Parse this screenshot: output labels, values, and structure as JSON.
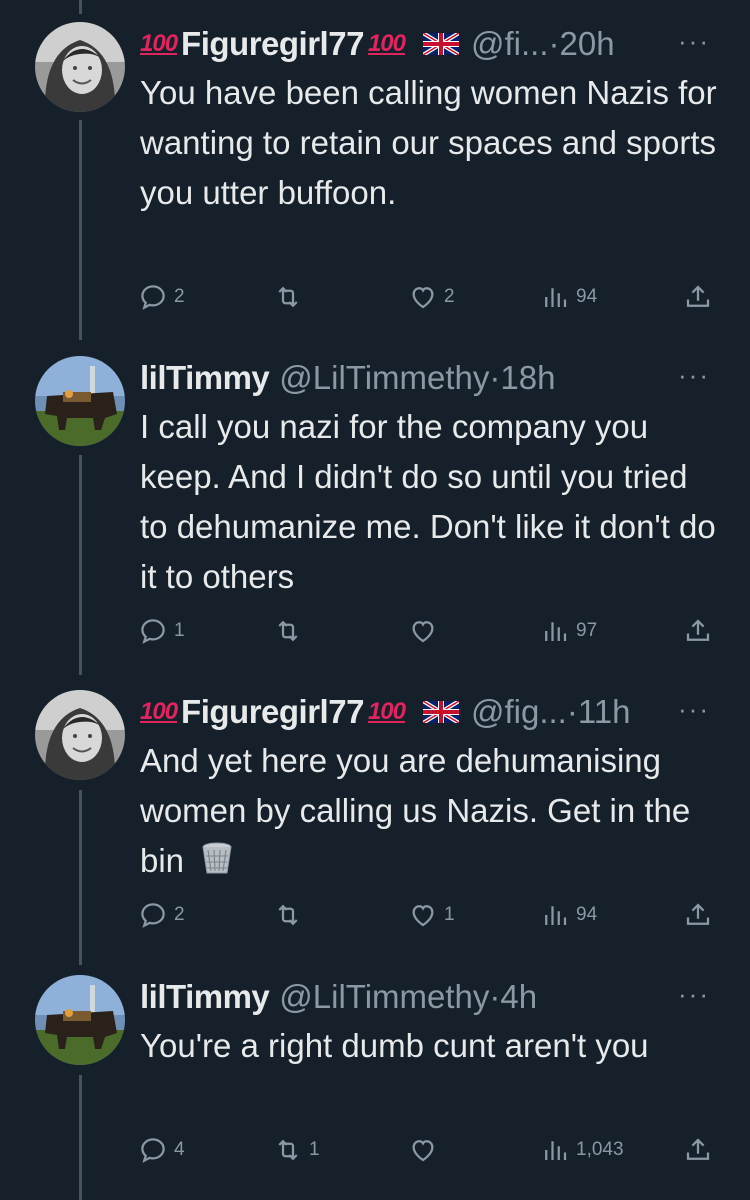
{
  "tweets": [
    {
      "display_name": "Figuregirl77",
      "prefix_emoji": "💯",
      "suffix_emoji": "💯",
      "flag": "🇬🇧",
      "handle": "@fi...",
      "separator": "·",
      "time": "20h",
      "more": "···",
      "text": "You have been calling women Nazis for wanting to retain our spaces and sports you utter buffoon.",
      "replies": "2",
      "retweets": "",
      "likes": "2",
      "views": "94"
    },
    {
      "display_name": "lilTimmy",
      "handle": "@LilTimmethy",
      "separator": "·",
      "time": "18h",
      "more": "···",
      "text": "I call you nazi for the company you keep. And I didn't do so until you tried to dehumanize me. Don't like it don't do it to others",
      "replies": "1",
      "retweets": "",
      "likes": "",
      "views": "97"
    },
    {
      "display_name": "Figuregirl77",
      "prefix_emoji": "💯",
      "suffix_emoji": "💯",
      "flag": "🇬🇧",
      "handle": "@fig...",
      "separator": "·",
      "time": "11h",
      "more": "···",
      "text": "And yet here you are dehumanising women by calling us Nazis.  Get in the bin",
      "trailing_emoji": "wastebasket-icon",
      "replies": "2",
      "retweets": "",
      "likes": "1",
      "views": "94"
    },
    {
      "display_name": "lilTimmy",
      "handle": "@LilTimmethy",
      "separator": "·",
      "time": "4h",
      "more": "···",
      "text": "You're a right dumb cunt aren't you",
      "replies": "4",
      "retweets": "1",
      "likes": "",
      "views": "1,043"
    }
  ],
  "colors": {
    "background": "#15202b",
    "text": "#e7e9ea",
    "muted": "#8b98a5",
    "thread_line": "#425364"
  }
}
